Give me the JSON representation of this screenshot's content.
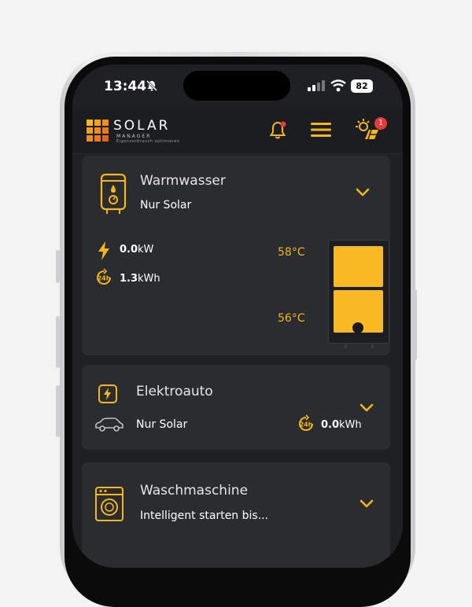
{
  "status_bar": {
    "time": "13:44",
    "battery": "82"
  },
  "header": {
    "logo_title": "SOLAR",
    "logo_subtitle": "MANAGER",
    "logo_tagline": "Eigenverbrauch optimieren",
    "notification_count": "1"
  },
  "cards": [
    {
      "title": "Warmwasser",
      "mode": "Nur Solar",
      "power_value": "0.0",
      "power_unit": "kW",
      "energy_value": "1.3",
      "energy_unit": "kWh",
      "temp_top": "58°C",
      "temp_bottom": "56°C"
    },
    {
      "title": "Elektroauto",
      "mode": "Nur Solar",
      "energy_value": "0.0",
      "energy_unit": "kWh"
    },
    {
      "title": "Waschmaschine",
      "mode": "Intelligent starten bis..."
    }
  ],
  "colors": {
    "accent": "#F8B923",
    "background": "#1F2023",
    "card": "#2B2C30",
    "badge": "#E33B3B"
  }
}
